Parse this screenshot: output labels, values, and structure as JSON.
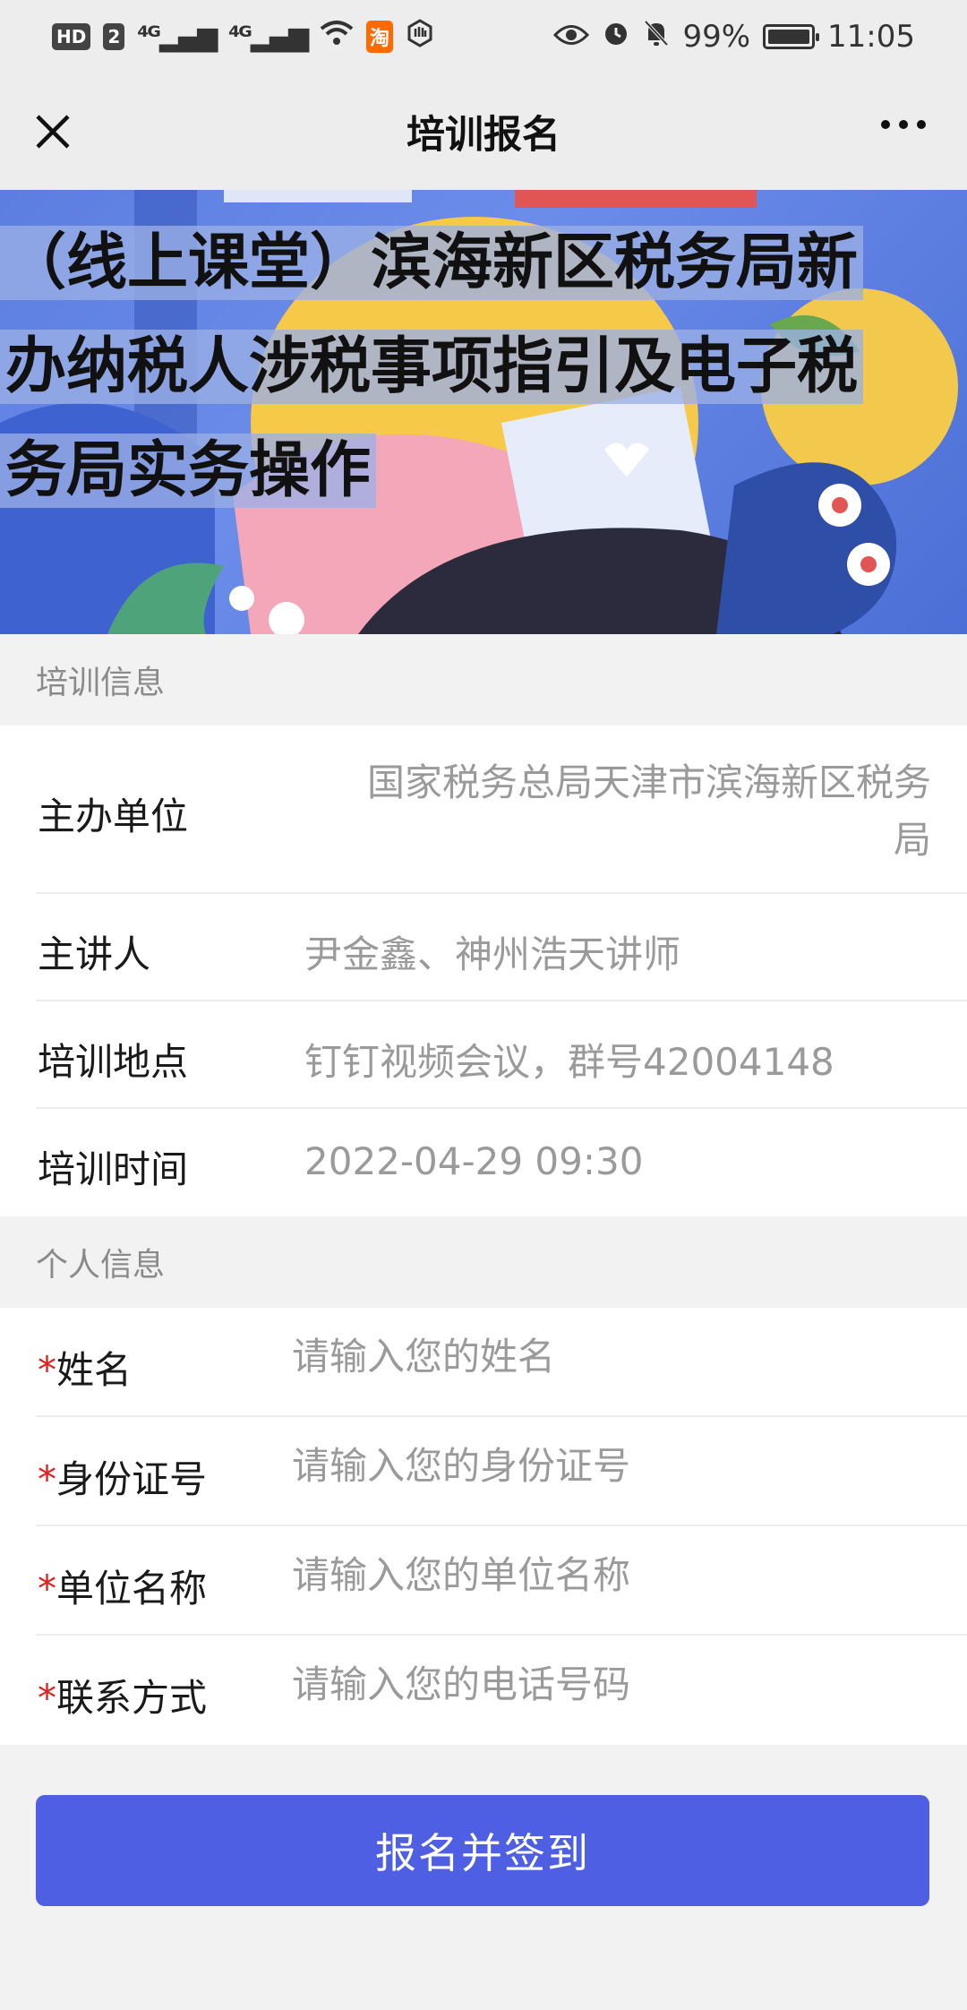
{
  "status_bar": {
    "hd_label": "HD",
    "sim_label": "2",
    "signal1": "⁴ᴳ",
    "signal2": "⁴ᴳ",
    "taobao_label": "淘",
    "battery_percent": "99%",
    "battery_level": 0.99,
    "time": "11:05"
  },
  "header": {
    "title": "培训报名"
  },
  "banner": {
    "title_line1": "（线上课堂）滨海新区税务局新",
    "title_line2": "办纳税人涉税事项指引及电子税",
    "title_line3": "务局实务操作"
  },
  "training_info": {
    "section_label": "培训信息",
    "rows": [
      {
        "label": "主办单位",
        "value_line1": "国家税务总局天津市滨海新区税务",
        "value_line2": "局"
      },
      {
        "label": "主讲人",
        "value": "尹金鑫、神州浩天讲师"
      },
      {
        "label": "培训地点",
        "value": "钉钉视频会议，群号42004148"
      },
      {
        "label": "培训时间",
        "value": "2022-04-29 09:30"
      }
    ]
  },
  "personal_info": {
    "section_label": "个人信息",
    "required_mark": "*",
    "fields": [
      {
        "label": "姓名",
        "placeholder": "请输入您的姓名"
      },
      {
        "label": "身份证号",
        "placeholder": "请输入您的身份证号"
      },
      {
        "label": "单位名称",
        "placeholder": "请输入您的单位名称"
      },
      {
        "label": "联系方式",
        "placeholder": "请输入您的电话号码"
      }
    ]
  },
  "submit_label": "报名并签到",
  "colors": {
    "accent": "#4e5fe3",
    "required": "#e02020"
  }
}
